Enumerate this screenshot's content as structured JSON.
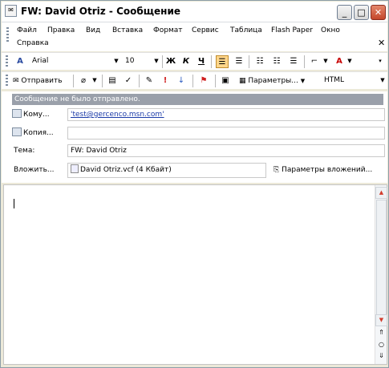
{
  "window": {
    "title": "FW: David Otriz - Сообщение",
    "buttons": {
      "minimize": "_",
      "maximize": "□",
      "close": "✕"
    }
  },
  "menu": {
    "items": [
      "Файл",
      "Правка",
      "Вид",
      "Вставка",
      "Формат",
      "Сервис",
      "Таблица",
      "Flash Paper",
      "Окно",
      "Справка"
    ],
    "close": "✕"
  },
  "format_toolbar": {
    "style_icon": "A",
    "font": "Arial",
    "size": "10",
    "bold": "Ж",
    "italic": "К",
    "underline": "Ч"
  },
  "send_toolbar": {
    "send_label": "Отправить",
    "options_label": "Параметры...",
    "format": "HTML"
  },
  "info_bar": "Сообщение не было отправлено.",
  "headers": {
    "to_label": "Кому...",
    "to_value": "'test@gercenco.msn.com'",
    "cc_label": "Копия...",
    "cc_value": "",
    "subject_label": "Тема:",
    "subject_value": "FW: David Otriz",
    "attach_label": "Вложить...",
    "attach_value": "David Otriz.vcf (4 Кбайт)",
    "attach_options": "Параметры вложений..."
  },
  "colors": {
    "info_bar_bg": "#9aa0aa",
    "link": "#1a3aa8",
    "active_format": "#ffd68a"
  },
  "icons": [
    "app-icon",
    "attach-icon",
    "address-book-icon",
    "check-names-icon",
    "signature-icon",
    "importance-high-icon",
    "importance-low-icon",
    "flag-icon",
    "options-icon",
    "font-color-icon",
    "bullets-icon",
    "numbering-icon",
    "indent-icon",
    "border-icon"
  ]
}
